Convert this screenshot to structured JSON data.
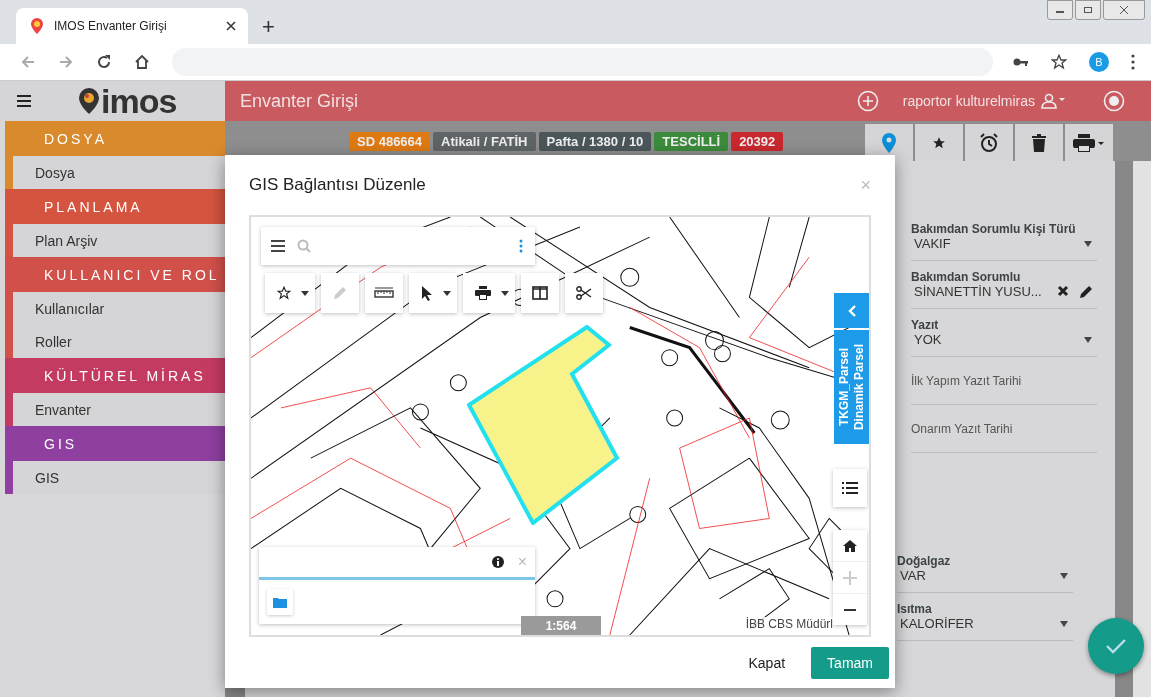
{
  "browser": {
    "tab_title": "IMOS Envanter Girişi",
    "new_tab": "+",
    "profile": "B"
  },
  "app": {
    "logo": "imos",
    "header_title": "Envanter Girişi",
    "user": "raportor kulturelmiras"
  },
  "sidebar": [
    {
      "section": "DOSYA",
      "color": "#d98a2c",
      "items": [
        "Dosya"
      ]
    },
    {
      "section": "PLANLAMA",
      "color": "#d4543f",
      "items": [
        "Plan Arşiv"
      ]
    },
    {
      "section": "KULLANICI VE ROL",
      "color": "#d1504a",
      "items": [
        "Kullanıcılar",
        "Roller"
      ]
    },
    {
      "section": "KÜLTÜREL MİRAS",
      "color": "#c43b62",
      "items": [
        "Envanter"
      ]
    },
    {
      "section": "GIS",
      "color": "#8e3fa0",
      "items": [
        "GIS"
      ]
    }
  ],
  "badges": [
    {
      "text": "SD 486664",
      "color": "#df7a12"
    },
    {
      "text": "Atikali / FATİH",
      "color": "#5f6467"
    },
    {
      "text": "Pafta / 1380 / 10",
      "color": "#4b565b"
    },
    {
      "text": "TESCİLLİ",
      "color": "#3c8b3c"
    },
    {
      "text": "20392",
      "color": "#c9282e"
    }
  ],
  "form_fields": [
    {
      "kind": "select",
      "label": "Bakımdan Sorumlu Kişi Türü",
      "value": "VAKIF"
    },
    {
      "kind": "person",
      "label": "Bakımdan Sorumlu",
      "value": "SİNANETTİN YUSU..."
    },
    {
      "kind": "select",
      "label": "Yazıt",
      "value": "YOK"
    },
    {
      "kind": "date",
      "placeholder": "İlk Yapım Yazıt Tarihi"
    },
    {
      "kind": "date",
      "placeholder": "Onarım Yazıt Tarihi"
    }
  ],
  "form_fields_2": [
    {
      "kind": "select",
      "label": "Doğalgaz",
      "value": "VAR"
    },
    {
      "kind": "select",
      "label": "Isıtma",
      "value": "KALORİFER"
    }
  ],
  "modal": {
    "title": "GIS Bağlantısı Düzenle",
    "close": "×",
    "map": {
      "layer_tabs": [
        "TKGM_Parsel",
        "Dinamik Parsel"
      ],
      "popup_close": "×",
      "scale": "1:564",
      "attribution": "İBB CBS Müdürl"
    },
    "buttons": [
      {
        "kind": "flat",
        "label": "Kapat"
      },
      {
        "kind": "primary",
        "label": "Tamam"
      }
    ]
  }
}
